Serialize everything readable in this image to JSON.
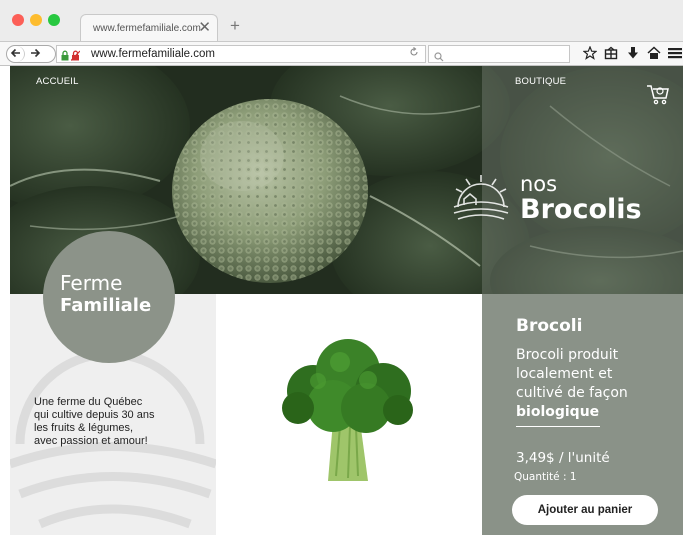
{
  "browser": {
    "tab_title": "www.fermefamiliale.com",
    "tab_close_glyph": "✕",
    "new_tab_glyph": "+",
    "url": "www.fermefamiliale.com",
    "search_placeholder": "",
    "icons": [
      "back-arrow-icon",
      "forward-arrow-icon",
      "lock-icon",
      "reload-icon",
      "search-icon",
      "bookmark-star-icon",
      "library-icon",
      "download-icon",
      "home-icon",
      "menu-icon"
    ]
  },
  "nav": {
    "home_label": "ACCUEIL",
    "shop_label": "BOUTIQUE"
  },
  "hero": {
    "line1": "nos",
    "line2": "Brocolis"
  },
  "badge": {
    "line1": "Ferme",
    "line2": "Familiale"
  },
  "intro": {
    "lines": [
      "Une ferme du Québec",
      "qui cultive depuis 30 ans",
      "les fruits & légumes,",
      "avec passion et amour!"
    ]
  },
  "product": {
    "name": "Brocoli",
    "description_lines": [
      "Brocoli produit",
      "localement et",
      "cultivé de façon"
    ],
    "description_emphasis": "biologique",
    "price": "3,49$ / l'unité",
    "quantity": "Quantité : 1",
    "button_label": "Ajouter au panier"
  },
  "colors": {
    "accent_gray": "#8a9288",
    "panel_light": "#efefef",
    "leaf_dark": "#2e3d2a",
    "broccoli_green": "#3f8a2a"
  }
}
